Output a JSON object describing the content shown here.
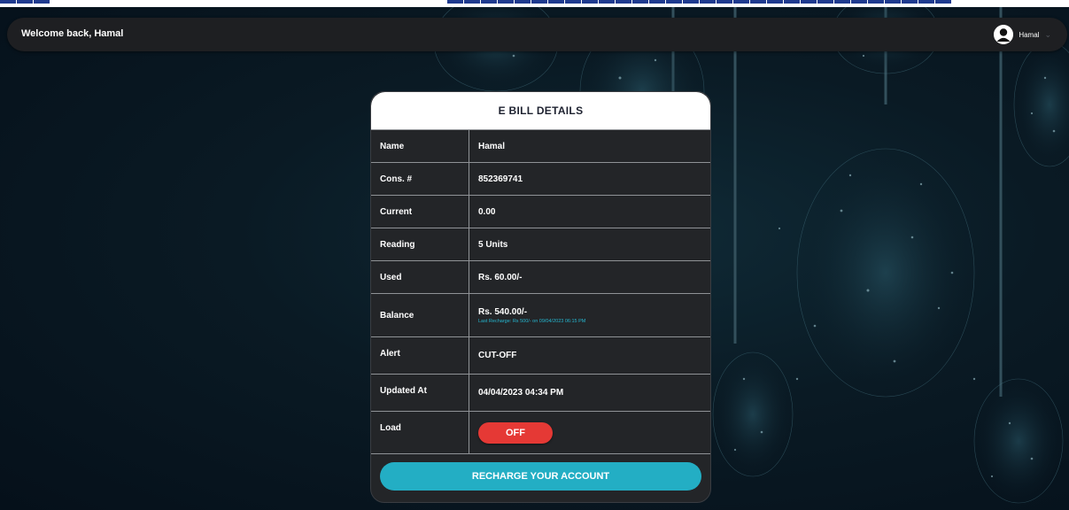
{
  "header": {
    "welcome_text": "Welcome back, Hamal",
    "user_name": "Hamal"
  },
  "bill_card": {
    "title": "E BILL DETAILS",
    "rows": [
      {
        "label": "Name",
        "value": "Hamal"
      },
      {
        "label": "Cons. #",
        "value": "852369741"
      },
      {
        "label": "Current",
        "value": "0.00"
      },
      {
        "label": "Reading",
        "value": "5 Units"
      },
      {
        "label": "Used",
        "value": "Rs. 60.00/-"
      },
      {
        "label": "Balance",
        "value": "Rs. 540.00/-",
        "note": "Last Recharge: Rs 500/- on 09/04/2023 06:15 PM"
      },
      {
        "label": "Alert",
        "value": "CUT-OFF"
      },
      {
        "label": "Updated At",
        "value": "04/04/2023 04:34 PM"
      },
      {
        "label": "Load",
        "value": "OFF"
      }
    ],
    "recharge_label": "RECHARGE YOUR ACCOUNT"
  },
  "colors": {
    "accent": "#23aec4",
    "danger": "#e53935",
    "card_bg": "#232528",
    "topbar_bg": "#1e1f22"
  },
  "icons": {
    "avatar": "user-avatar-icon",
    "chevron": "chevron-down-icon"
  }
}
